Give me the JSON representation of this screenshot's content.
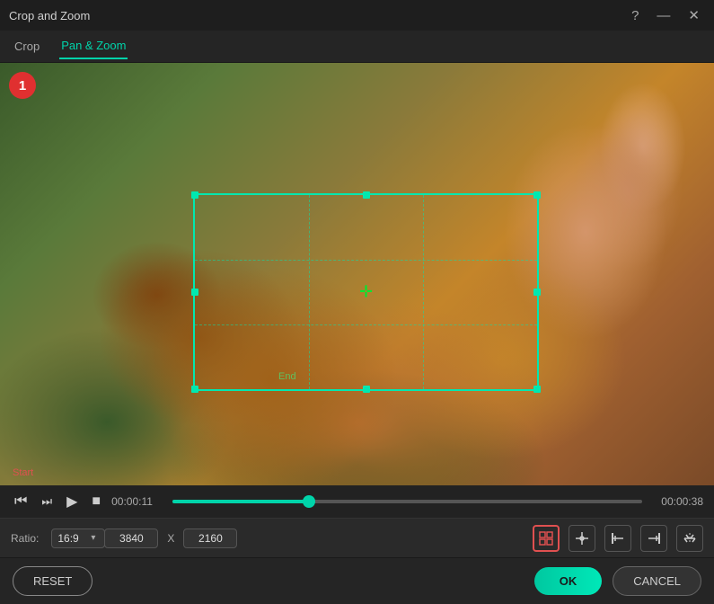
{
  "window": {
    "title": "Crop and Zoom"
  },
  "tabs": [
    {
      "id": "crop",
      "label": "Crop",
      "active": false
    },
    {
      "id": "pan-zoom",
      "label": "Pan & Zoom",
      "active": true
    }
  ],
  "video": {
    "keyframe_number": "1",
    "start_label": "Start",
    "end_label": "End",
    "current_time": "00:00:11",
    "total_time": "00:00:38"
  },
  "controls": {
    "ratio_label": "Ratio:",
    "ratio_value": "16:9",
    "width": "3840",
    "x_sep": "X",
    "height": "2160"
  },
  "toolbar": {
    "reset_label": "RESET",
    "ok_label": "OK",
    "cancel_label": "CANCEL"
  },
  "icons": {
    "help": "?",
    "minimize": "—",
    "close": "✕",
    "skip-back": "⏮",
    "step-back": "⏭",
    "play": "▶",
    "stop": "■",
    "fit-icon": "⛶",
    "center-icon": "✛",
    "align-left-icon": "⊢",
    "align-right-icon": "⊣",
    "flip-icon": "⇄",
    "move-icon": "✛"
  }
}
